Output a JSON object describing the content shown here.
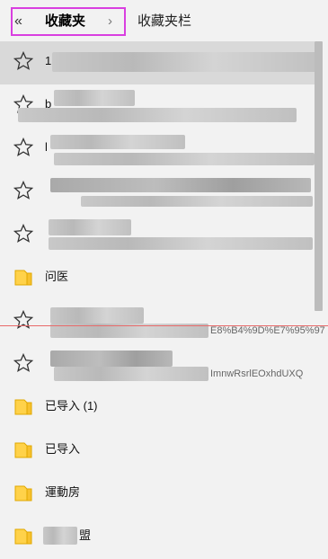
{
  "header": {
    "back_icon": "«",
    "title": "收藏夹",
    "chevron": "›",
    "bar_label": "收藏夹栏"
  },
  "rows": [
    {
      "kind": "star",
      "label": "1",
      "tail": ""
    },
    {
      "kind": "star",
      "label": "b",
      "tail": ""
    },
    {
      "kind": "star",
      "label": "l",
      "tail": ""
    },
    {
      "kind": "star",
      "label": "",
      "tail": ""
    },
    {
      "kind": "star",
      "label": "",
      "tail": ""
    },
    {
      "kind": "folder",
      "label": "问医",
      "tail": ""
    },
    {
      "kind": "star",
      "label": "",
      "tail": "E8%B4%9D%E7%95%97"
    },
    {
      "kind": "star",
      "label": "",
      "tail": "ImnwRsrlEOxhdUXQ"
    },
    {
      "kind": "folder",
      "label": "已导入 (1)",
      "tail": ""
    },
    {
      "kind": "folder",
      "label": "已导入",
      "tail": ""
    },
    {
      "kind": "folder",
      "label": "運動房",
      "tail": ""
    },
    {
      "kind": "folder",
      "label": "盟",
      "tail": ""
    }
  ],
  "colors": {
    "highlight_border": "#d93fe0",
    "folder_fill": "#ffd24a",
    "folder_stroke": "#e0a800",
    "selected_row": "#d9d9d9",
    "divider_line": "#e86a6a"
  }
}
